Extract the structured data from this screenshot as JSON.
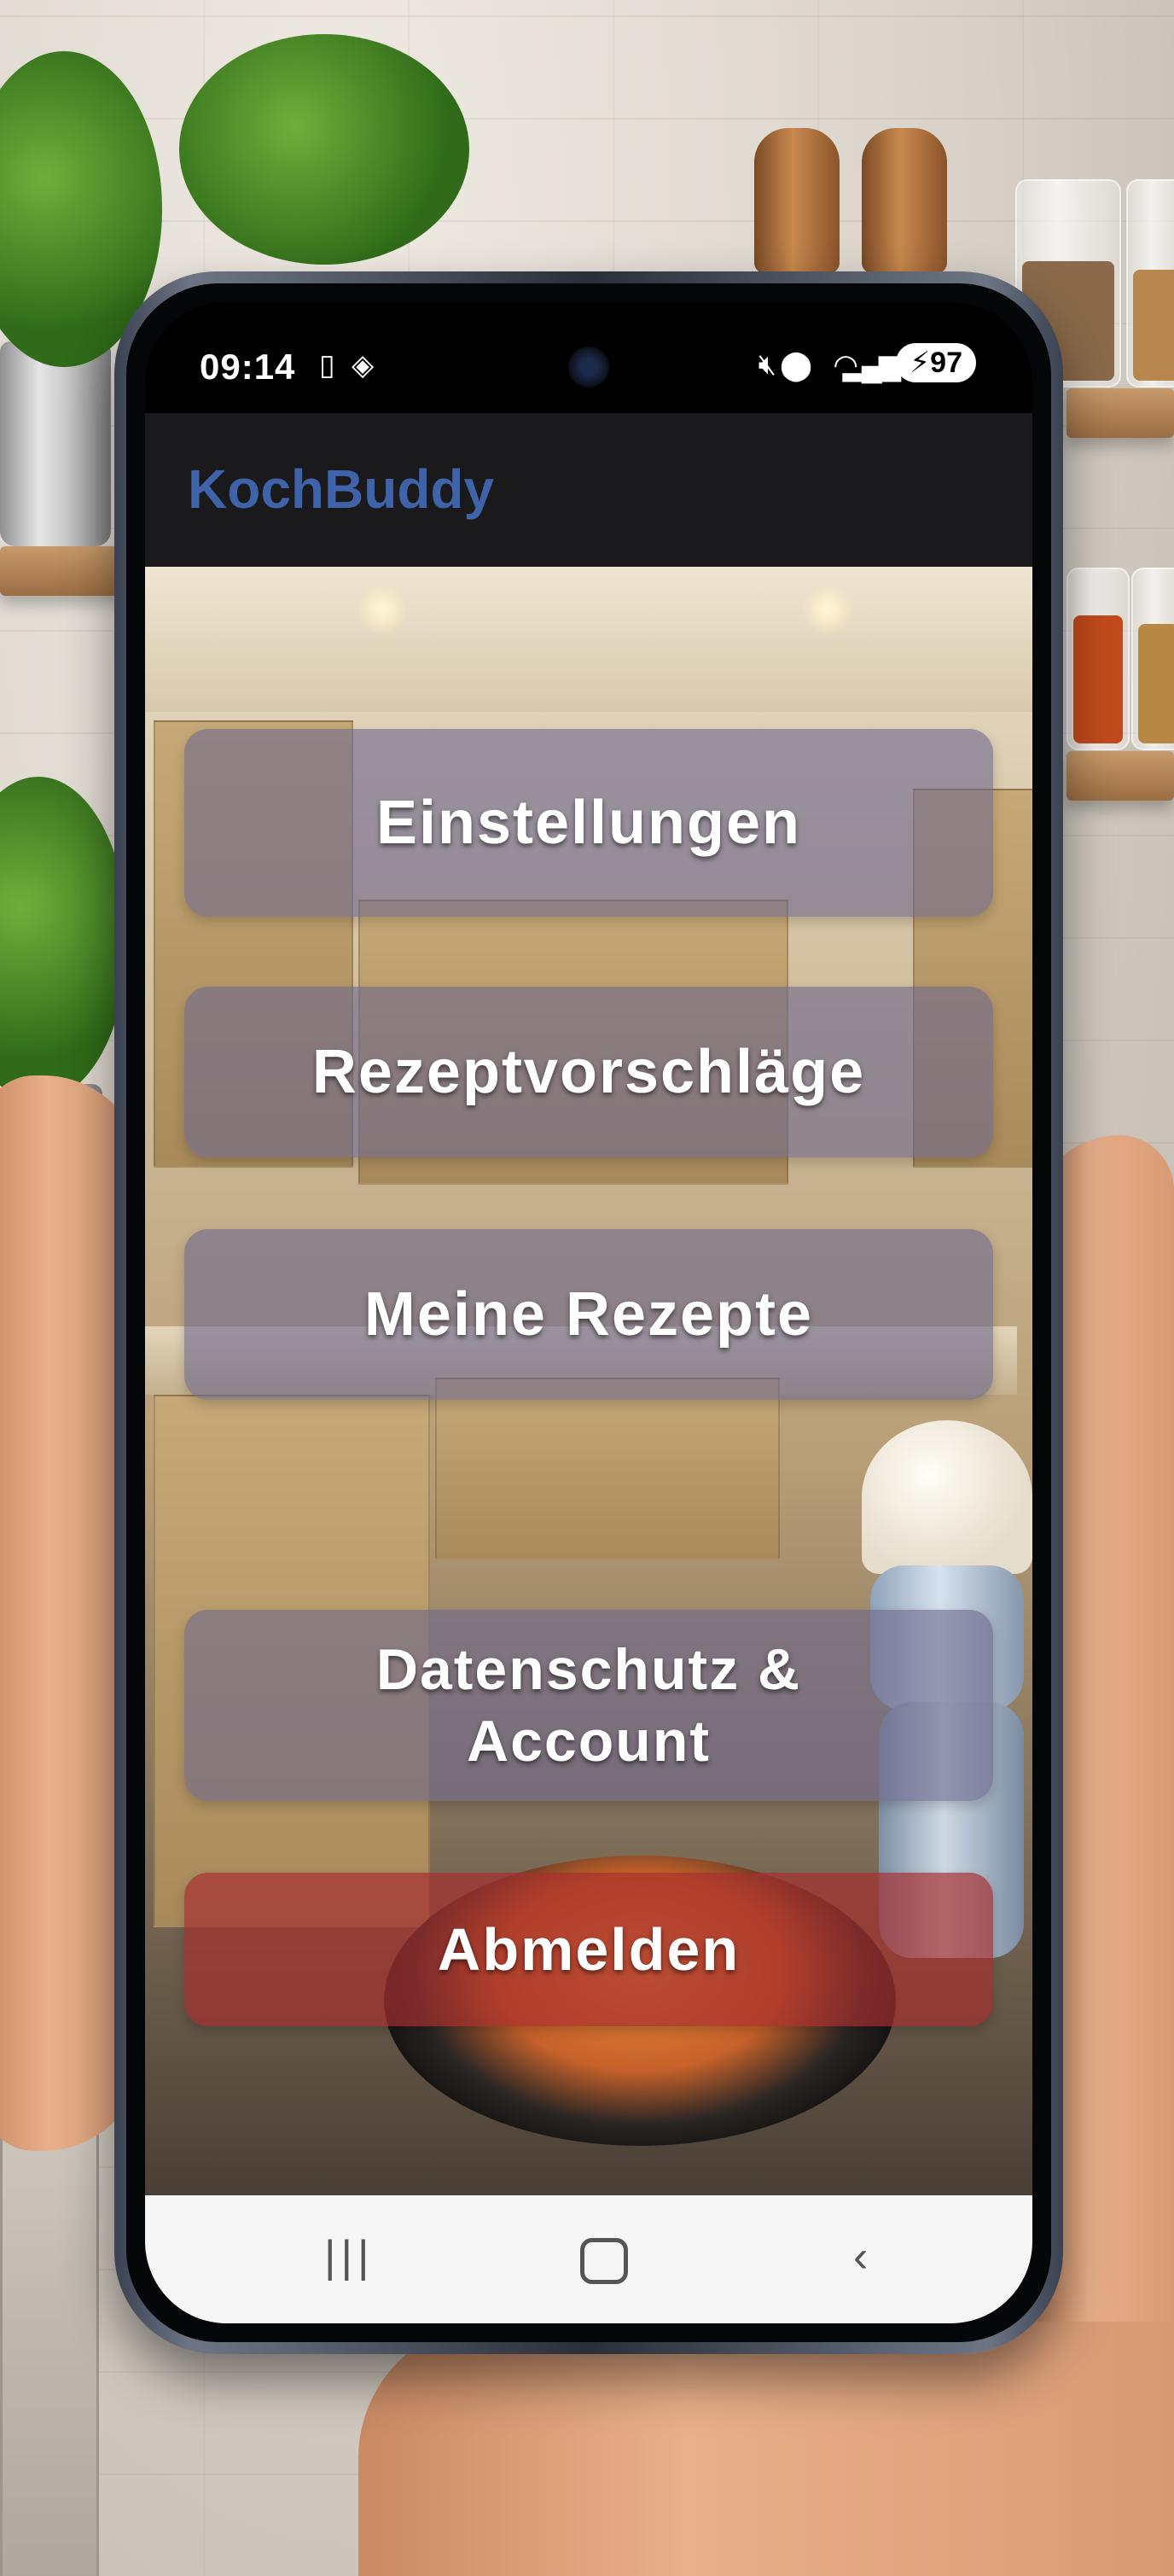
{
  "status_bar": {
    "time": "09:14",
    "battery": "97",
    "icons": [
      "screen-cast-icon",
      "nfc-icon",
      "mute-icon",
      "location-icon",
      "wifi-icon",
      "signal-icon"
    ]
  },
  "app_bar": {
    "title": "KochBuddy",
    "title_color": "#3f63a8"
  },
  "menu": {
    "items": [
      {
        "label": "Einstellungen"
      },
      {
        "label": "Rezeptvorschläge"
      },
      {
        "label": "Meine Rezepte"
      },
      {
        "label_line1": "Datenschutz &",
        "label_line2": "Account"
      },
      {
        "label": "Abmelden"
      }
    ],
    "button_color": "#6e698c",
    "logout_color": "#a52d2d"
  },
  "nav_bar": {
    "icons": [
      "recent-apps-icon",
      "home-icon",
      "back-icon"
    ]
  }
}
